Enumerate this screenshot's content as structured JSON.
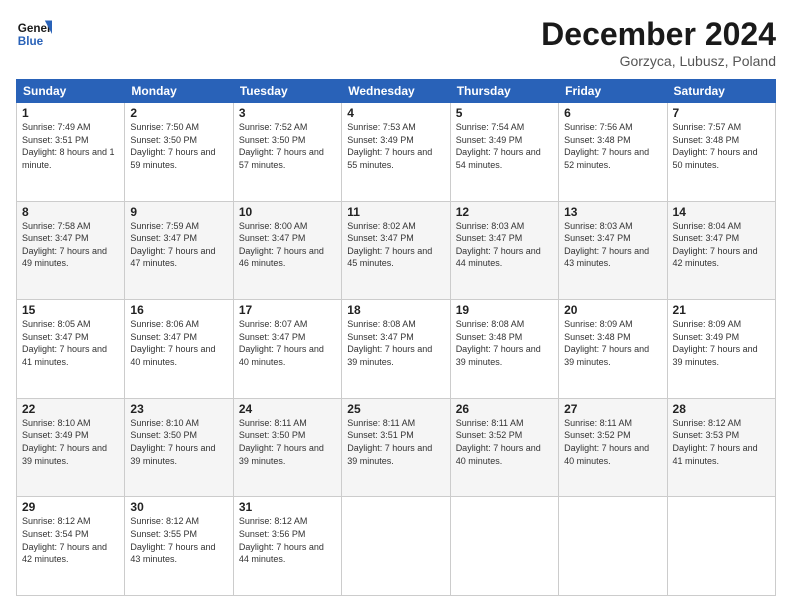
{
  "logo": {
    "line1": "General",
    "line2": "Blue"
  },
  "title": "December 2024",
  "subtitle": "Gorzyca, Lubusz, Poland",
  "days_header": [
    "Sunday",
    "Monday",
    "Tuesday",
    "Wednesday",
    "Thursday",
    "Friday",
    "Saturday"
  ],
  "weeks": [
    [
      {
        "day": "1",
        "sunrise": "7:49 AM",
        "sunset": "3:51 PM",
        "daylight": "8 hours and 1 minute."
      },
      {
        "day": "2",
        "sunrise": "7:50 AM",
        "sunset": "3:50 PM",
        "daylight": "7 hours and 59 minutes."
      },
      {
        "day": "3",
        "sunrise": "7:52 AM",
        "sunset": "3:50 PM",
        "daylight": "7 hours and 57 minutes."
      },
      {
        "day": "4",
        "sunrise": "7:53 AM",
        "sunset": "3:49 PM",
        "daylight": "7 hours and 55 minutes."
      },
      {
        "day": "5",
        "sunrise": "7:54 AM",
        "sunset": "3:49 PM",
        "daylight": "7 hours and 54 minutes."
      },
      {
        "day": "6",
        "sunrise": "7:56 AM",
        "sunset": "3:48 PM",
        "daylight": "7 hours and 52 minutes."
      },
      {
        "day": "7",
        "sunrise": "7:57 AM",
        "sunset": "3:48 PM",
        "daylight": "7 hours and 50 minutes."
      }
    ],
    [
      {
        "day": "8",
        "sunrise": "7:58 AM",
        "sunset": "3:47 PM",
        "daylight": "7 hours and 49 minutes."
      },
      {
        "day": "9",
        "sunrise": "7:59 AM",
        "sunset": "3:47 PM",
        "daylight": "7 hours and 47 minutes."
      },
      {
        "day": "10",
        "sunrise": "8:00 AM",
        "sunset": "3:47 PM",
        "daylight": "7 hours and 46 minutes."
      },
      {
        "day": "11",
        "sunrise": "8:02 AM",
        "sunset": "3:47 PM",
        "daylight": "7 hours and 45 minutes."
      },
      {
        "day": "12",
        "sunrise": "8:03 AM",
        "sunset": "3:47 PM",
        "daylight": "7 hours and 44 minutes."
      },
      {
        "day": "13",
        "sunrise": "8:03 AM",
        "sunset": "3:47 PM",
        "daylight": "7 hours and 43 minutes."
      },
      {
        "day": "14",
        "sunrise": "8:04 AM",
        "sunset": "3:47 PM",
        "daylight": "7 hours and 42 minutes."
      }
    ],
    [
      {
        "day": "15",
        "sunrise": "8:05 AM",
        "sunset": "3:47 PM",
        "daylight": "7 hours and 41 minutes."
      },
      {
        "day": "16",
        "sunrise": "8:06 AM",
        "sunset": "3:47 PM",
        "daylight": "7 hours and 40 minutes."
      },
      {
        "day": "17",
        "sunrise": "8:07 AM",
        "sunset": "3:47 PM",
        "daylight": "7 hours and 40 minutes."
      },
      {
        "day": "18",
        "sunrise": "8:08 AM",
        "sunset": "3:47 PM",
        "daylight": "7 hours and 39 minutes."
      },
      {
        "day": "19",
        "sunrise": "8:08 AM",
        "sunset": "3:48 PM",
        "daylight": "7 hours and 39 minutes."
      },
      {
        "day": "20",
        "sunrise": "8:09 AM",
        "sunset": "3:48 PM",
        "daylight": "7 hours and 39 minutes."
      },
      {
        "day": "21",
        "sunrise": "8:09 AM",
        "sunset": "3:49 PM",
        "daylight": "7 hours and 39 minutes."
      }
    ],
    [
      {
        "day": "22",
        "sunrise": "8:10 AM",
        "sunset": "3:49 PM",
        "daylight": "7 hours and 39 minutes."
      },
      {
        "day": "23",
        "sunrise": "8:10 AM",
        "sunset": "3:50 PM",
        "daylight": "7 hours and 39 minutes."
      },
      {
        "day": "24",
        "sunrise": "8:11 AM",
        "sunset": "3:50 PM",
        "daylight": "7 hours and 39 minutes."
      },
      {
        "day": "25",
        "sunrise": "8:11 AM",
        "sunset": "3:51 PM",
        "daylight": "7 hours and 39 minutes."
      },
      {
        "day": "26",
        "sunrise": "8:11 AM",
        "sunset": "3:52 PM",
        "daylight": "7 hours and 40 minutes."
      },
      {
        "day": "27",
        "sunrise": "8:11 AM",
        "sunset": "3:52 PM",
        "daylight": "7 hours and 40 minutes."
      },
      {
        "day": "28",
        "sunrise": "8:12 AM",
        "sunset": "3:53 PM",
        "daylight": "7 hours and 41 minutes."
      }
    ],
    [
      {
        "day": "29",
        "sunrise": "8:12 AM",
        "sunset": "3:54 PM",
        "daylight": "7 hours and 42 minutes."
      },
      {
        "day": "30",
        "sunrise": "8:12 AM",
        "sunset": "3:55 PM",
        "daylight": "7 hours and 43 minutes."
      },
      {
        "day": "31",
        "sunrise": "8:12 AM",
        "sunset": "3:56 PM",
        "daylight": "7 hours and 44 minutes."
      },
      null,
      null,
      null,
      null
    ]
  ]
}
